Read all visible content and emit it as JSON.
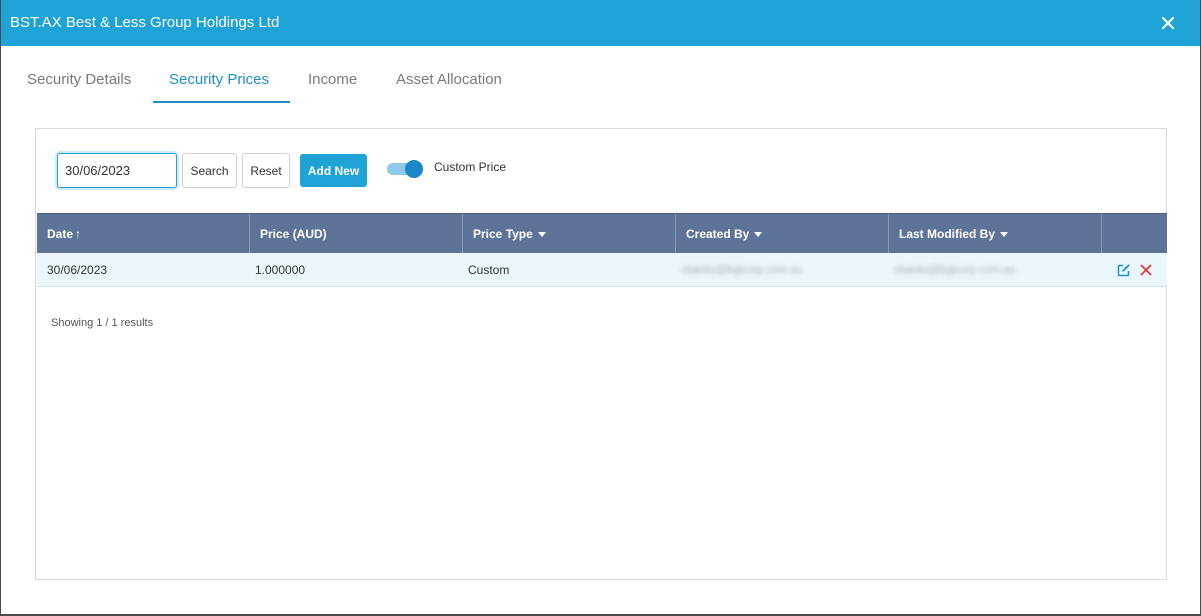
{
  "modal": {
    "title": "BST.AX Best & Less Group Holdings Ltd",
    "close_icon": "close-icon"
  },
  "tabs": [
    {
      "label": "Security Details",
      "active": false
    },
    {
      "label": "Security Prices",
      "active": true
    },
    {
      "label": "Income",
      "active": false
    },
    {
      "label": "Asset Allocation",
      "active": false
    }
  ],
  "toolbar": {
    "date_value": "30/06/2023",
    "search_label": "Search",
    "reset_label": "Reset",
    "add_new_label": "Add New",
    "custom_price_label": "Custom Price",
    "custom_price_on": true
  },
  "table": {
    "columns": [
      {
        "label": "Date",
        "sort": "asc"
      },
      {
        "label": "Price (AUD)"
      },
      {
        "label": "Price Type",
        "dropdown": true
      },
      {
        "label": "Created By",
        "dropdown": true
      },
      {
        "label": "Last Modified By",
        "dropdown": true
      }
    ],
    "rows": [
      {
        "date": "30/06/2023",
        "price": "1.000000",
        "price_type": "Custom",
        "created_by": "cbanks@bglcorp.com.au",
        "last_modified_by": "cbanks@bglcorp.com.au"
      }
    ]
  },
  "results_text": "Showing 1 / 1 results",
  "colors": {
    "header": "#1fa3d6",
    "grid_header": "#5d7397",
    "row_highlight": "#e9f6fb",
    "delete": "#e53935",
    "edit": "#1e8ec9"
  }
}
